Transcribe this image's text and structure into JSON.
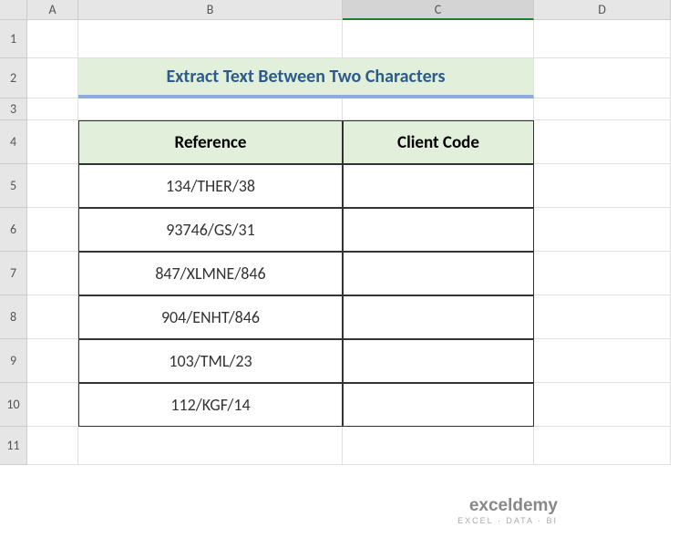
{
  "columns": [
    "A",
    "B",
    "C",
    "D"
  ],
  "rows": [
    "1",
    "2",
    "3",
    "4",
    "5",
    "6",
    "7",
    "8",
    "9",
    "10",
    "11"
  ],
  "title": "Extract Text Between Two Characters",
  "headers": {
    "reference": "Reference",
    "client_code": "Client Code"
  },
  "data": [
    {
      "reference": "134/THER/38",
      "client_code": ""
    },
    {
      "reference": "93746/GS/31",
      "client_code": ""
    },
    {
      "reference": "847/XLMNE/846",
      "client_code": ""
    },
    {
      "reference": "904/ENHT/846",
      "client_code": ""
    },
    {
      "reference": "103/TML/23",
      "client_code": ""
    },
    {
      "reference": "112/KGF/14",
      "client_code": ""
    }
  ],
  "watermark": {
    "brand": "exceldemy",
    "tagline": "EXCEL · DATA · BI"
  },
  "selected_column": "C"
}
